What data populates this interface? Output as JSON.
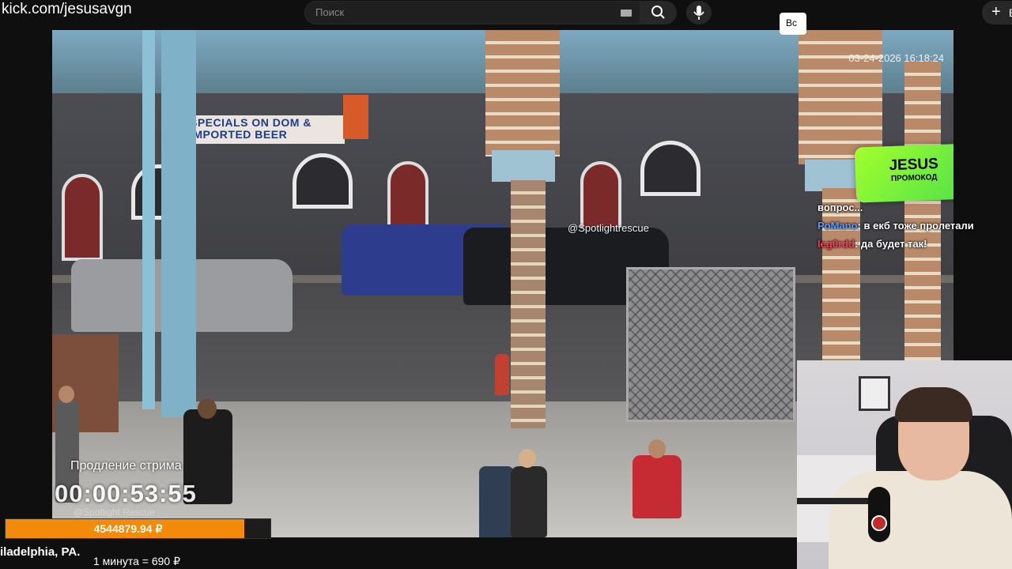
{
  "browser": {
    "url": "kick.com/jesusavgn"
  },
  "search": {
    "placeholder": "Поиск"
  },
  "header": {
    "create_symbol": "+",
    "create_label": "Вс"
  },
  "video": {
    "timestamp": "03-24-2026 16:18:24",
    "watermark": "@Spotlightrescue",
    "store_sign": "SPECIALS ON DOM & IMPORTED BEER"
  },
  "promo": {
    "title": "JESUS",
    "subtitle": "ПРОМОКОД"
  },
  "chat": {
    "messages": [
      {
        "user": "",
        "text": "вопрос..."
      },
      {
        "user": "PoMano",
        "text": ": в екб тоже пролетали"
      },
      {
        "user": "leg0rdd",
        "text": ": да будет так!"
      }
    ]
  },
  "extension": {
    "label": "Продление стрима",
    "timer": "00:00:53:55",
    "watermark": "@Spotlight Rescue",
    "amount": "4544879.94 ₽",
    "progress": 0.9
  },
  "caption": {
    "location": "iladelphia, PA.",
    "rate": "1 минута = 690 ₽"
  },
  "overlay_button": {
    "label": "Вс"
  },
  "colors": {
    "progress": "#f48a0a",
    "promo": "#8bf33a",
    "chat_user_blue": "#5b9cff",
    "chat_user_red": "#ff3b55"
  },
  "icons": [
    "keyboard-icon",
    "search-icon",
    "microphone-icon",
    "plus-icon"
  ]
}
